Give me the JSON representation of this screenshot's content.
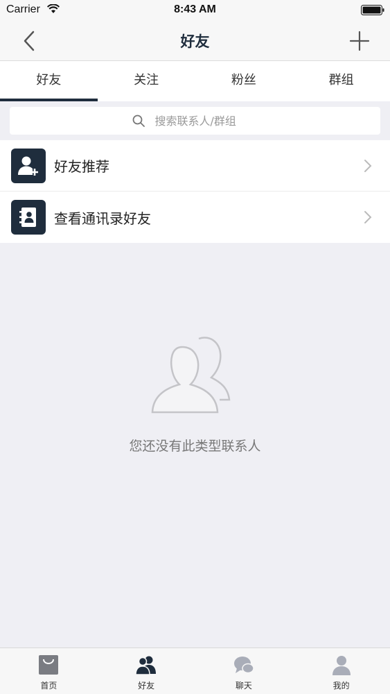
{
  "status_bar": {
    "carrier": "Carrier",
    "time": "8:43 AM"
  },
  "nav": {
    "title": "好友"
  },
  "tabs": [
    {
      "label": "好友",
      "active": true
    },
    {
      "label": "关注",
      "active": false
    },
    {
      "label": "粉丝",
      "active": false
    },
    {
      "label": "群组",
      "active": false
    }
  ],
  "search": {
    "placeholder": "搜索联系人/群组"
  },
  "list": [
    {
      "label": "好友推荐",
      "icon": "add-user-icon"
    },
    {
      "label": "查看通讯录好友",
      "icon": "contacts-book-icon"
    }
  ],
  "empty_state": {
    "text": "您还没有此类型联系人",
    "icon": "contacts-empty-icon"
  },
  "tab_bar": [
    {
      "label": "首页",
      "icon": "shopping-bag-icon",
      "active": false
    },
    {
      "label": "好友",
      "icon": "friends-icon",
      "active": true
    },
    {
      "label": "聊天",
      "icon": "chat-icon",
      "active": false
    },
    {
      "label": "我的",
      "icon": "profile-icon",
      "active": false
    }
  ],
  "colors": {
    "accent": "#1f2d3d",
    "background": "#efeff4",
    "inactive_icon": "#a9adb8"
  }
}
